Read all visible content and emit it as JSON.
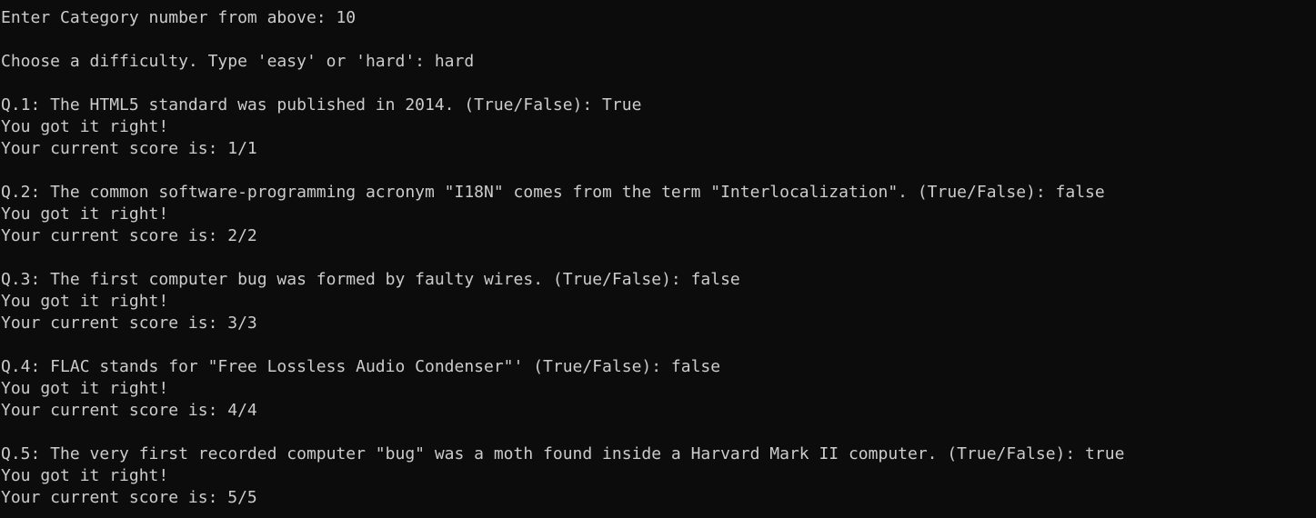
{
  "terminal": {
    "prompt_category": "Enter Category number from above: 10",
    "prompt_difficulty": "Choose a difficulty. Type 'easy' or 'hard': hard",
    "questions": [
      {
        "question": "Q.1: The HTML5 standard was published in 2014. (True/False): True",
        "feedback": "You got it right!",
        "score": "Your current score is: 1/1"
      },
      {
        "question": "Q.2: The common software-programming acronym \"I18N\" comes from the term \"Interlocalization\". (True/False): false",
        "feedback": "You got it right!",
        "score": "Your current score is: 2/2"
      },
      {
        "question": "Q.3: The first computer bug was formed by faulty wires. (True/False): false",
        "feedback": "You got it right!",
        "score": "Your current score is: 3/3"
      },
      {
        "question": "Q.4: FLAC stands for \"Free Lossless Audio Condenser\"' (True/False): false",
        "feedback": "You got it right!",
        "score": "Your current score is: 4/4"
      },
      {
        "question": "Q.5: The very first recorded computer \"bug\" was a moth found inside a Harvard Mark II computer. (True/False): true",
        "feedback": "You got it right!",
        "score": "Your current score is: 5/5"
      }
    ]
  },
  "colors": {
    "background": "#0c0c0c",
    "text": "#cccccc"
  }
}
